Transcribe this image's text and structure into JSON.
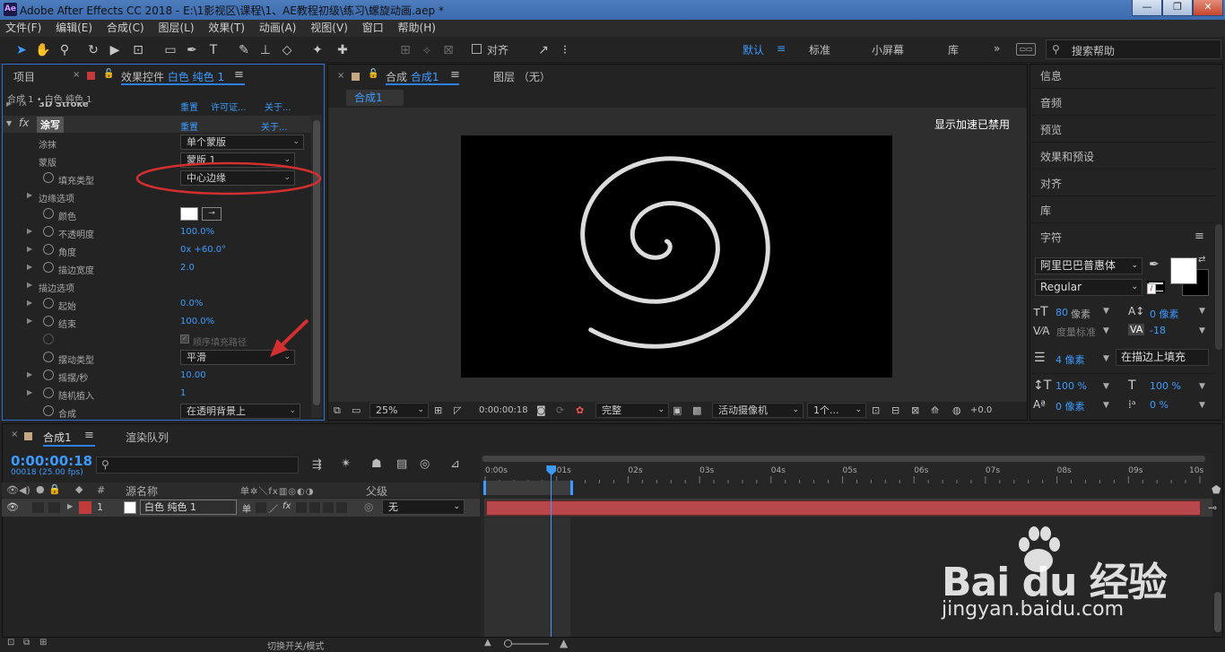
{
  "window": {
    "app_icon": "Ae",
    "title": "Adobe After Effects CC 2018 - E:\\1影视区\\课程\\1、AE教程初级\\练习\\螺旋动画.aep *",
    "min": "—",
    "max": "❐",
    "close": "✕"
  },
  "menu": [
    "文件(F)",
    "编辑(E)",
    "合成(C)",
    "图层(L)",
    "效果(T)",
    "动画(A)",
    "视图(V)",
    "窗口",
    "帮助(H)"
  ],
  "toolbar": {
    "align_label": "对齐",
    "workspaces": [
      "默认",
      "标准",
      "小屏幕",
      "库"
    ],
    "search_placeholder": "搜索帮助"
  },
  "effect_panel": {
    "tab_project": "项目",
    "tab_effects_prefix": "效果控件",
    "tab_effects_layer": "白色 纯色 1",
    "breadcrumb": "合成 1 • 白色 纯色 1",
    "prev_effect": "3D Stroke",
    "prev_reset": "重置",
    "prev_reg": "许可证...",
    "prev_about": "关于...",
    "effect_name": "涂写",
    "reset": "重置",
    "about": "关于...",
    "rows": {
      "scribble_label": "涂抹",
      "scribble_value": "单个蒙版",
      "mask_label": "蒙版",
      "mask_value": "蒙版 1",
      "fill_type_label": "填充类型",
      "fill_type_value": "中心边缘",
      "edge_options": "边缘选项",
      "color_label": "颜色",
      "opacity_label": "不透明度",
      "opacity_value": "100.0%",
      "angle_label": "角度",
      "angle_value": "0x +60.0°",
      "stroke_width_label": "描边宽度",
      "stroke_width_value": "2.0",
      "stroke_options": "描边选项",
      "start_label": "起始",
      "start_value": "0.0%",
      "end_label": "结束",
      "end_value": "100.0%",
      "fill_paths_label": "顺序填充路径",
      "wiggle_type_label": "摆动类型",
      "wiggle_type_value": "平滑",
      "wiggles_label": "摇摆/秒",
      "wiggles_value": "10.00",
      "random_seed_label": "随机植入",
      "random_seed_value": "1",
      "composite_label": "合成",
      "composite_value": "在透明背景上"
    },
    "colors": {
      "swatch": "#ffffff",
      "annotation": "#d32f2f"
    }
  },
  "comp_panel": {
    "tab_prefix": "合成",
    "tab_name": "合成1",
    "layer_tab": "图层 （无）",
    "subtab": "合成1",
    "gpu_notice": "显示加速已禁用",
    "zoom": "25%",
    "timecode": "0:00:00:18",
    "quality": "完整",
    "camera": "活动摄像机",
    "views": "1个...",
    "exposure": "+0.0"
  },
  "right_panels": {
    "items": [
      "信息",
      "音频",
      "预览",
      "效果和预设",
      "对齐",
      "库"
    ],
    "character_title": "字符",
    "font_family": "阿里巴巴普惠体",
    "font_style": "Regular",
    "font_size": "80",
    "px_unit": "像素",
    "leading": "0 像素",
    "kerning": "度量标准",
    "tracking": "-18",
    "stroke_width": "4 像素",
    "stroke_mode": "在描边上填充",
    "v_scale": "100 %",
    "h_scale": "100 %",
    "baseline": "0 像素",
    "tsume": "0 %",
    "fill_color": "#ffffff",
    "stroke_color": "#000000"
  },
  "timeline": {
    "tab_comp": "合成1",
    "tab_render": "渲染队列",
    "timecode": "0:00:00:18",
    "frames": "00018 (25.00 fps)",
    "col_hash": "#",
    "col_source": "源名称",
    "col_parent": "父级",
    "layer_index": "1",
    "layer_name": "白色 纯色 1",
    "parent_value": "无",
    "ruler": [
      "0:00s",
      "01s",
      "02s",
      "03s",
      "04s",
      "05s",
      "06s",
      "07s",
      "08s",
      "09s",
      "10s"
    ],
    "footer": "切换开关/模式",
    "playhead_seconds": 0.72,
    "label_color": "#c13b3b",
    "bar_color": "#b8474c"
  },
  "watermark": {
    "brand": "Bai du 经验",
    "url": "jingyan.baidu.com"
  }
}
